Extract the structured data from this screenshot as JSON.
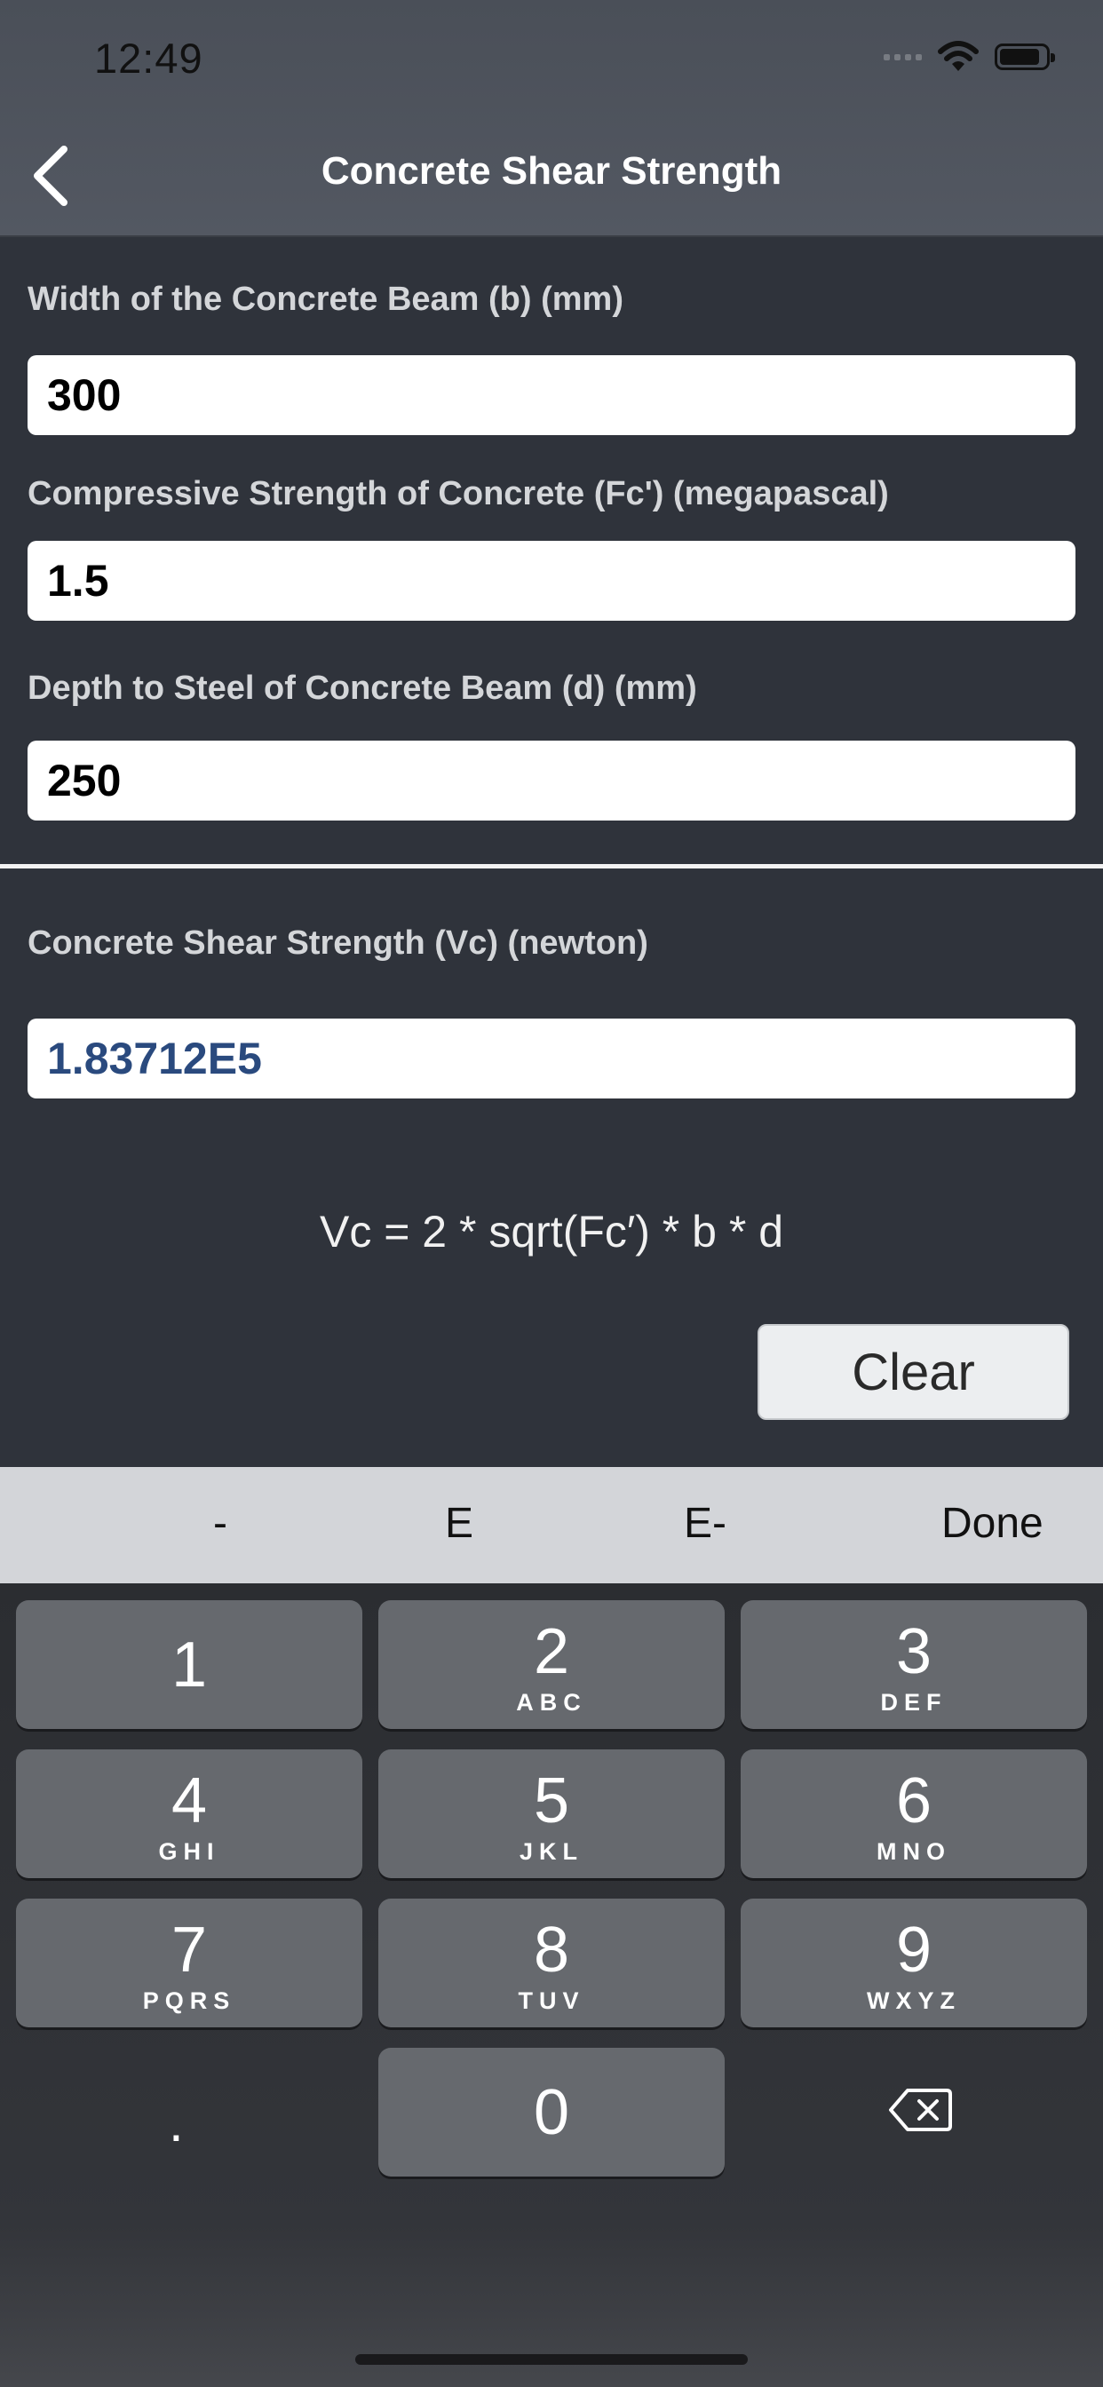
{
  "status_bar": {
    "time": "12:49"
  },
  "nav": {
    "title": "Concrete Shear Strength",
    "back_icon": "chevron-left-icon"
  },
  "form": {
    "fields": [
      {
        "label": "Width of the Concrete Beam (b) (mm)",
        "value": "300"
      },
      {
        "label": "Compressive Strength of Concrete (Fc') (megapascal)",
        "value": "1.5"
      },
      {
        "label": "Depth to Steel of Concrete Beam (d) (mm)",
        "value": "250"
      }
    ],
    "result": {
      "label": "Concrete Shear Strength (Vc) (newton)",
      "value": "1.83712E5",
      "color": "#2a4a7e"
    },
    "formula": "Vc = 2 * sqrt(Fc′) * b * d",
    "clear_label": "Clear"
  },
  "accessory": {
    "minus": "-",
    "e": "E",
    "e_minus": "E-",
    "done": "Done"
  },
  "keypad": [
    {
      "digit": "1",
      "letters": ""
    },
    {
      "digit": "2",
      "letters": "ABC"
    },
    {
      "digit": "3",
      "letters": "DEF"
    },
    {
      "digit": "4",
      "letters": "GHI"
    },
    {
      "digit": "5",
      "letters": "JKL"
    },
    {
      "digit": "6",
      "letters": "MNO"
    },
    {
      "digit": "7",
      "letters": "PQRS"
    },
    {
      "digit": "8",
      "letters": "TUV"
    },
    {
      "digit": "9",
      "letters": "WXYZ"
    },
    {
      "digit": "0",
      "letters": ""
    }
  ],
  "keypad_extra": {
    "dot": ".",
    "delete_icon": "backspace-icon"
  },
  "colors": {
    "background": "#2f333b",
    "nav_bar": "#4f545d",
    "key": "#66696e",
    "accessory_bar": "#d3d5d9"
  }
}
